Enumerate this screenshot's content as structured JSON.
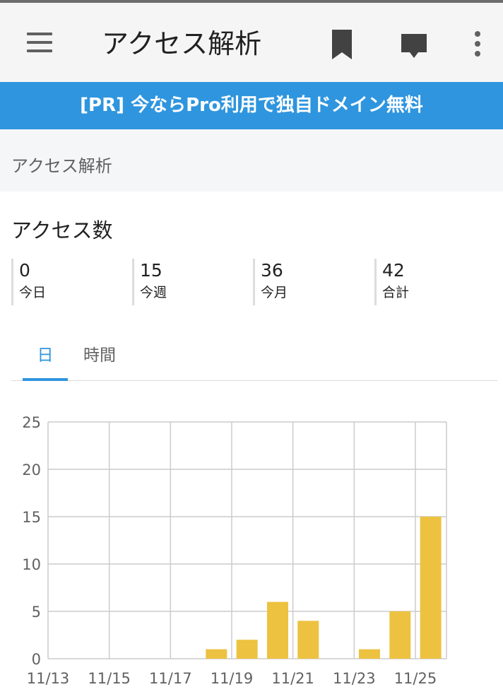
{
  "app_bar": {
    "title": "アクセス解析",
    "icons": [
      "menu-icon",
      "bookmark-icon",
      "comment-icon",
      "more-vert-icon"
    ]
  },
  "promo": {
    "text": "[PR] 今ならPro利用で独自ドメイン無料"
  },
  "section": {
    "header": "アクセス解析"
  },
  "access": {
    "title": "アクセス数",
    "stats": [
      {
        "value": "0",
        "label": "今日"
      },
      {
        "value": "15",
        "label": "今週"
      },
      {
        "value": "36",
        "label": "今月"
      },
      {
        "value": "42",
        "label": "合計"
      }
    ]
  },
  "tabs": {
    "day": "日",
    "hour": "時間",
    "selected": "日"
  },
  "colors": {
    "accent": "#2f95de",
    "bar": "#edc240"
  },
  "chart_data": {
    "type": "bar",
    "x": [
      "11/13",
      "11/14",
      "11/15",
      "11/16",
      "11/17",
      "11/18",
      "11/19",
      "11/20",
      "11/21",
      "11/22",
      "11/23",
      "11/24",
      "11/25"
    ],
    "values": [
      0,
      0,
      0,
      0,
      0,
      1,
      2,
      6,
      4,
      0,
      1,
      5,
      15
    ],
    "xticks": [
      "11/13",
      "11/15",
      "11/17",
      "11/19",
      "11/21",
      "11/23",
      "11/25"
    ],
    "yticks": [
      "0",
      "5",
      "10",
      "15",
      "20",
      "25"
    ],
    "ylim": [
      0,
      25
    ],
    "grid": true,
    "title": "",
    "xlabel": "",
    "ylabel": ""
  }
}
